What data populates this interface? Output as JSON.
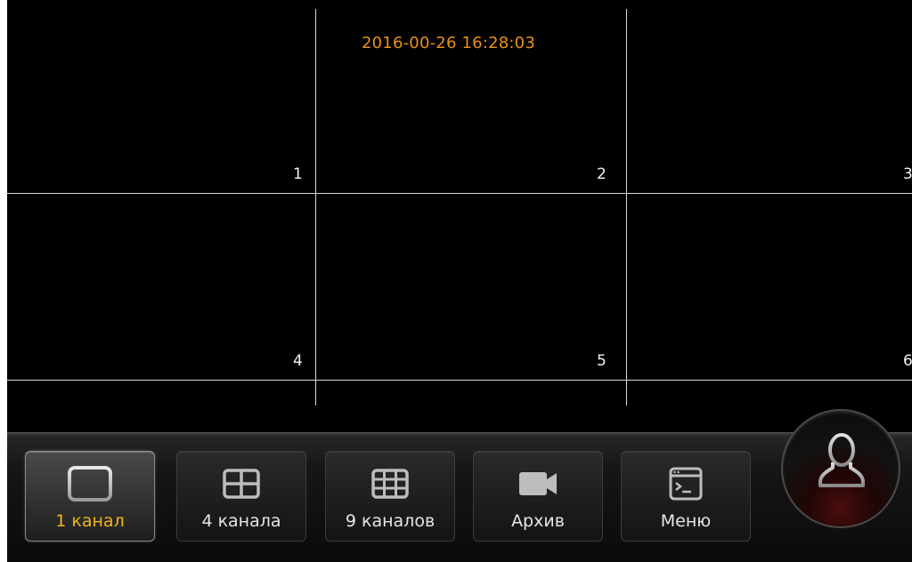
{
  "overlay": {
    "timestamp": "2016-00-26 16:28:03"
  },
  "grid": {
    "channels": [
      {
        "number": "1"
      },
      {
        "number": "2"
      },
      {
        "number": "3"
      },
      {
        "number": "4"
      },
      {
        "number": "5"
      },
      {
        "number": "6"
      }
    ]
  },
  "toolbar": {
    "buttons": [
      {
        "label": "1 канал",
        "icon": "single-view-icon",
        "active": true
      },
      {
        "label": "4 канала",
        "icon": "quad-view-icon",
        "active": false
      },
      {
        "label": "9 каналов",
        "icon": "nine-view-icon",
        "active": false
      },
      {
        "label": "Архив",
        "icon": "video-camera-icon",
        "active": false
      },
      {
        "label": "Меню",
        "icon": "terminal-window-icon",
        "active": false
      }
    ],
    "user_icon": "user-icon"
  },
  "colors": {
    "timestamp": "#e8901c",
    "active_label": "#f2b519",
    "grid_lines": "#d9d9d9",
    "background": "#000000"
  }
}
